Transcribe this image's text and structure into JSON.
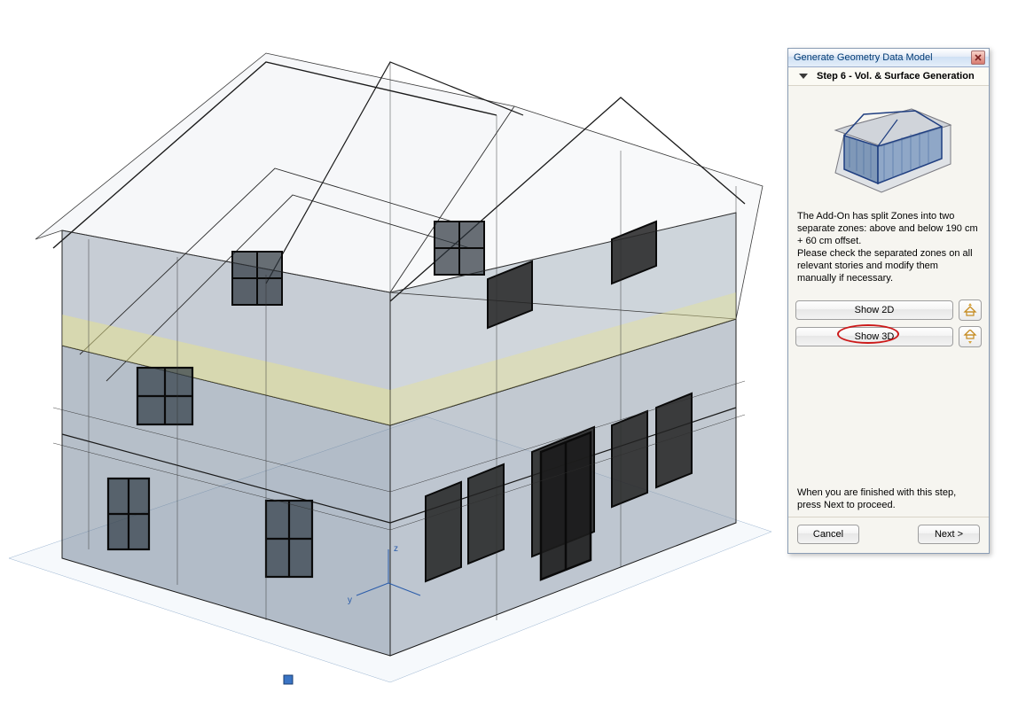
{
  "panel": {
    "title": "Generate Geometry Data Model",
    "step_label": "Step 6 - Vol. & Surface Generation",
    "description1": "The Add-On has split Zones into two separate zones: above and below 190 cm + 60 cm offset.",
    "description2": "Please check the separated zones on all relevant stories and modify them manually if necessary.",
    "show2d_label": "Show 2D",
    "show3d_label": "Show 3D",
    "finish_note": "When you are finished with this step, press Next to proceed.",
    "cancel_label": "Cancel",
    "next_label": "Next >"
  },
  "icons": {
    "story_up": "story-up-icon",
    "story_down": "story-down-icon"
  },
  "highlight": {
    "target": "show3d-button"
  },
  "viewport": {
    "content": "3D wireframe perspective of a two-story residential building with hipped roof, dormers, windows with shutters, rendered in semi-transparent grey-blue wireframe over a light ground plane."
  }
}
